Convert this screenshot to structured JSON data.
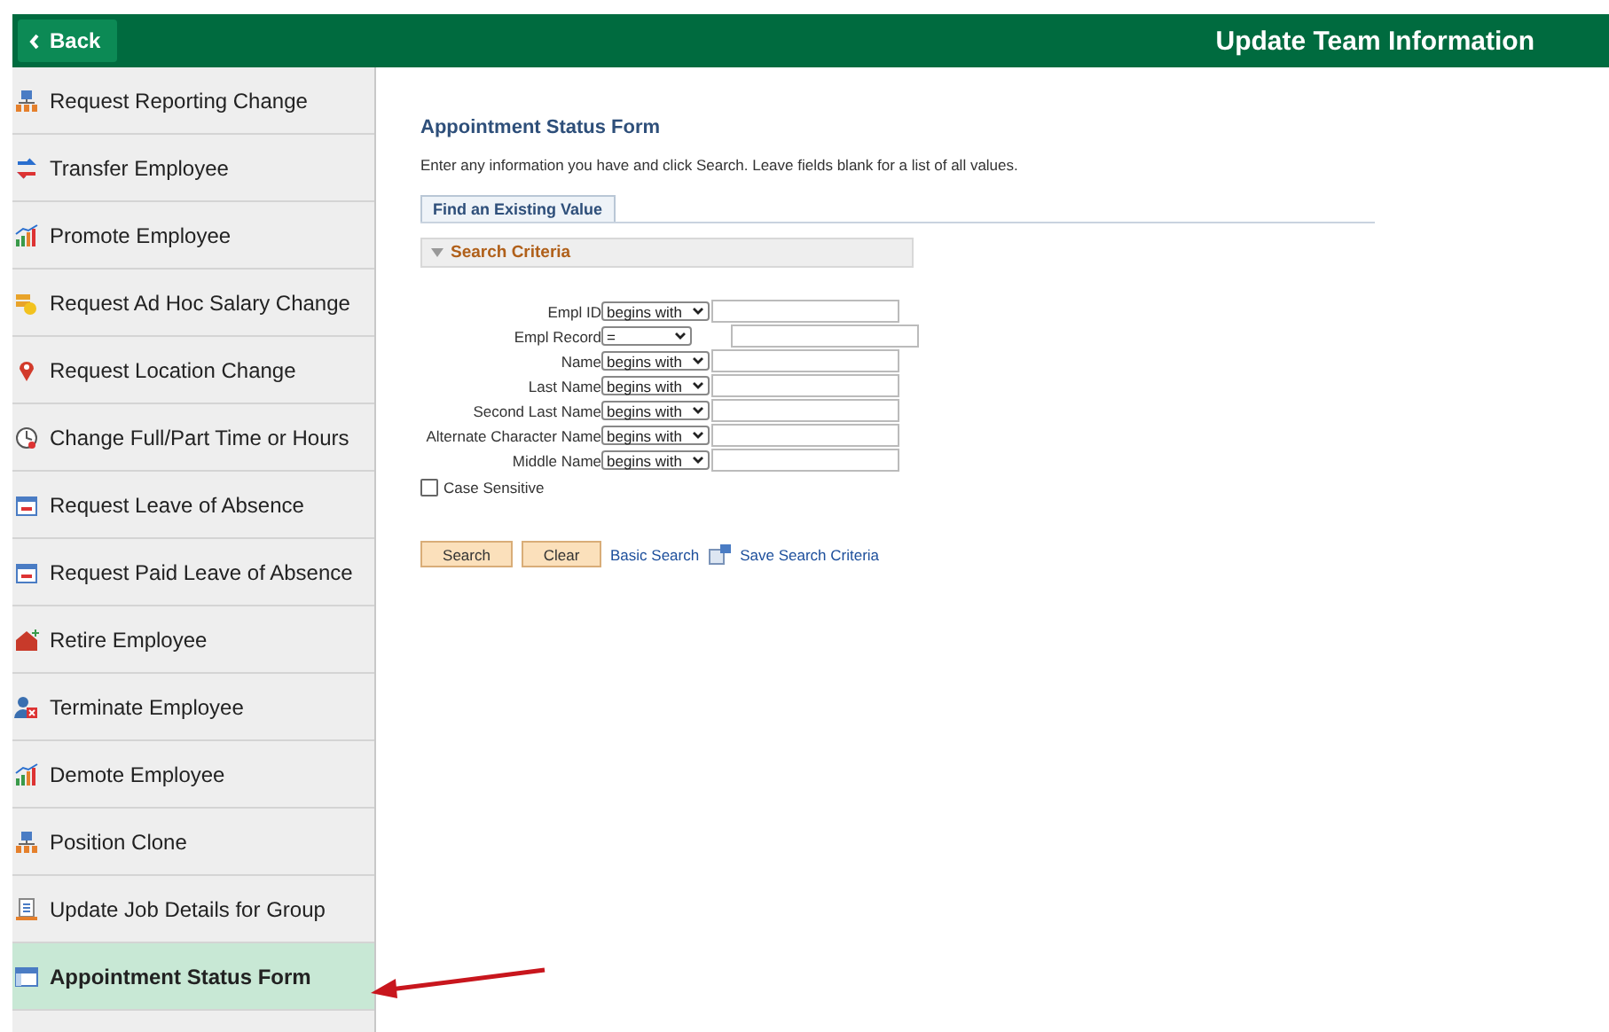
{
  "header": {
    "back": "Back",
    "title": "Update Team Information"
  },
  "sidebar": {
    "items": [
      {
        "label": "Request Reporting Change",
        "kind": "org",
        "selected": false
      },
      {
        "label": "Transfer Employee",
        "kind": "transfer",
        "selected": false
      },
      {
        "label": "Promote Employee",
        "kind": "chart",
        "selected": false
      },
      {
        "label": "Request Ad Hoc Salary Change",
        "kind": "coins",
        "selected": false
      },
      {
        "label": "Request Location Change",
        "kind": "pin",
        "selected": false
      },
      {
        "label": "Change Full/Part Time or Hours",
        "kind": "clock",
        "selected": false
      },
      {
        "label": "Request Leave of Absence",
        "kind": "calendar",
        "selected": false
      },
      {
        "label": "Request Paid Leave of Absence",
        "kind": "calendar",
        "selected": false
      },
      {
        "label": "Retire Employee",
        "kind": "house",
        "selected": false
      },
      {
        "label": "Terminate Employee",
        "kind": "person",
        "selected": false
      },
      {
        "label": "Demote Employee",
        "kind": "chart",
        "selected": false
      },
      {
        "label": "Position Clone",
        "kind": "org",
        "selected": false
      },
      {
        "label": "Update Job Details for Group",
        "kind": "doc",
        "selected": false
      },
      {
        "label": "Appointment Status Form",
        "kind": "form",
        "selected": true
      }
    ]
  },
  "form": {
    "title": "Appointment Status Form",
    "instructions": "Enter any information you have and click Search. Leave fields blank for a list of all values.",
    "tab": "Find an Existing Value",
    "section": "Search Criteria",
    "fields": [
      {
        "label": "Empl ID",
        "operator": "begins with"
      },
      {
        "label": "Empl Record",
        "operator": "="
      },
      {
        "label": "Name",
        "operator": "begins with"
      },
      {
        "label": "Last Name",
        "operator": "begins with"
      },
      {
        "label": "Second Last Name",
        "operator": "begins with"
      },
      {
        "label": "Alternate Character Name",
        "operator": "begins with"
      },
      {
        "label": "Middle Name",
        "operator": "begins with"
      }
    ],
    "case_sensitive": {
      "label": "Case Sensitive",
      "checked": false
    },
    "buttons": [
      "Search",
      "Clear"
    ],
    "links": [
      "Basic Search",
      "Save Search Criteria"
    ]
  }
}
